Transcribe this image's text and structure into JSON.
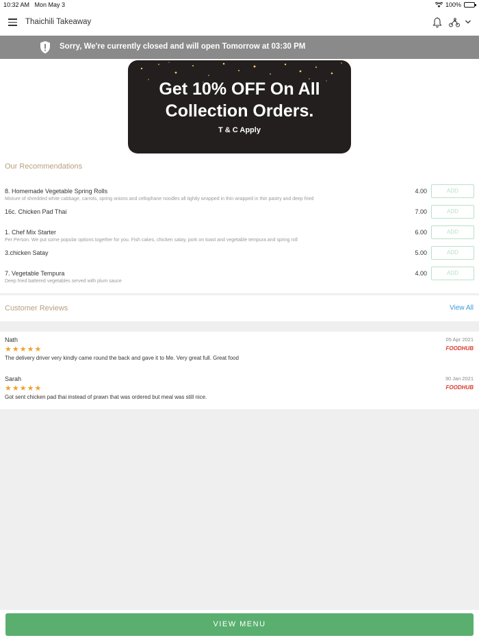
{
  "status_bar": {
    "time": "10:32 AM",
    "date": "Mon May 3",
    "battery": "100%",
    "battery_level": 1.0
  },
  "nav": {
    "title": "Thaichili Takeaway",
    "icons": [
      "menu-icon",
      "bell-icon",
      "rider-icon",
      "chevron-down-icon"
    ]
  },
  "banner": {
    "text": "Sorry, We're currently closed and will open Tomorrow at 03:30 PM",
    "icon": "shield-alert-icon"
  },
  "promo": {
    "line1": "Get 10% OFF On All",
    "line2": "Collection Orders.",
    "tc": "T & C Apply"
  },
  "recommendations": {
    "title": "Our Recommendations",
    "add_label": "ADD",
    "items": [
      {
        "name": "8. Homemade Vegetable Spring Rolls",
        "description": "Mixture of shredded white cabbage, carrots, spring onions and cellophane noodles all tightly wrapped in thin wrapped in thin pastry and deep fried",
        "price": "4.00"
      },
      {
        "name": "16c. Chicken Pad Thai",
        "description": "",
        "price": "7.00"
      },
      {
        "name": "1. Chef Mix Starter",
        "description": "Per Person. We put some popular options together for you. Fish cakes, chicken satay, pork on toast and vegetable tempura and spring roll",
        "price": "6.00"
      },
      {
        "name": "3.chicken Satay",
        "description": "",
        "price": "5.00"
      },
      {
        "name": "7. Vegetable Tempura",
        "description": "Deep fried battered vegetables served with plum sauce",
        "price": "4.00"
      }
    ]
  },
  "reviews": {
    "title": "Customer Reviews",
    "view_all": "View All",
    "items": [
      {
        "author": "Nath",
        "date": "05 Apr 2021",
        "stars": "★★★★★",
        "rating": 5,
        "source": "FOODHUB",
        "text": "The delivery driver very kindly came round the back and gave it to Me. Very great full. Great food"
      },
      {
        "author": "Sarah",
        "date": "30 Jan 2021",
        "stars": "★★★★★",
        "rating": 5,
        "source": "FOODHUB",
        "text": "Got sent chicken pad thai instead of prawn that was ordered but meal was still nice."
      }
    ]
  },
  "footer": {
    "button": "VIEW MENU"
  },
  "colors": {
    "accent_green": "#5aaf6f",
    "banner_gray": "#8a8a8a",
    "section_title": "#b79f7d",
    "link_blue": "#3a9ad9",
    "star": "#f0a030",
    "brand_red": "#d93a2b"
  }
}
